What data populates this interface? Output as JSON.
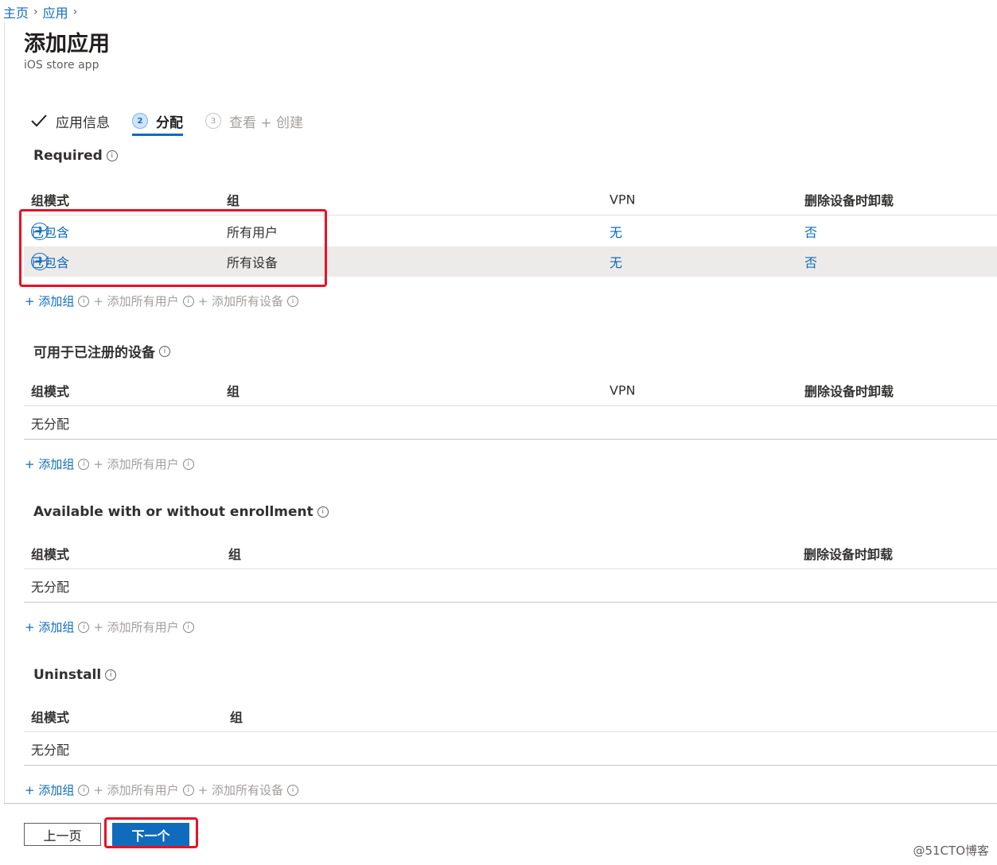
{
  "breadcrumb": {
    "home": "主页",
    "apps": "应用"
  },
  "page": {
    "title": "添加应用",
    "subtitle": "iOS store app"
  },
  "steps": [
    {
      "label": "应用信息",
      "num": ""
    },
    {
      "label": "分配",
      "num": "2"
    },
    {
      "label": "查看 + 创建",
      "num": "3"
    }
  ],
  "required": {
    "title": "Required",
    "headers": {
      "mode": "组模式",
      "group": "组",
      "vpn": "VPN",
      "uninstall": "删除设备时卸载"
    },
    "rows": [
      {
        "mode": "已包含",
        "group": "所有用户",
        "vpn": "无",
        "uninstall": "否"
      },
      {
        "mode": "已包含",
        "group": "所有设备",
        "vpn": "无",
        "uninstall": "否"
      }
    ],
    "actions": {
      "add_group": "+ 添加组",
      "add_all_users": "+ 添加所有用户",
      "add_all_devices": "+ 添加所有设备"
    }
  },
  "enrolled": {
    "title": "可用于已注册的设备",
    "headers": {
      "mode": "组模式",
      "group": "组",
      "vpn": "VPN",
      "uninstall": "删除设备时卸载"
    },
    "empty": "无分配",
    "actions": {
      "add_group": "+ 添加组",
      "add_all_users": "+ 添加所有用户"
    }
  },
  "available": {
    "title": "Available with or without enrollment",
    "headers": {
      "mode": "组模式",
      "group": "组",
      "uninstall": "删除设备时卸载"
    },
    "empty": "无分配",
    "actions": {
      "add_group": "+ 添加组",
      "add_all_users": "+ 添加所有用户"
    }
  },
  "uninstall": {
    "title": "Uninstall",
    "headers": {
      "mode": "组模式",
      "group": "组"
    },
    "empty": "无分配",
    "actions": {
      "add_group": "+ 添加组",
      "add_all_users": "+ 添加所有用户",
      "add_all_devices": "+ 添加所有设备"
    }
  },
  "footer": {
    "prev": "上一页",
    "next": "下一个"
  },
  "info_glyph": "i",
  "plus_glyph": "+",
  "watermark": "@51CTO博客",
  "colors": {
    "accent": "#0f6cbd",
    "highlight": "#e81123"
  }
}
